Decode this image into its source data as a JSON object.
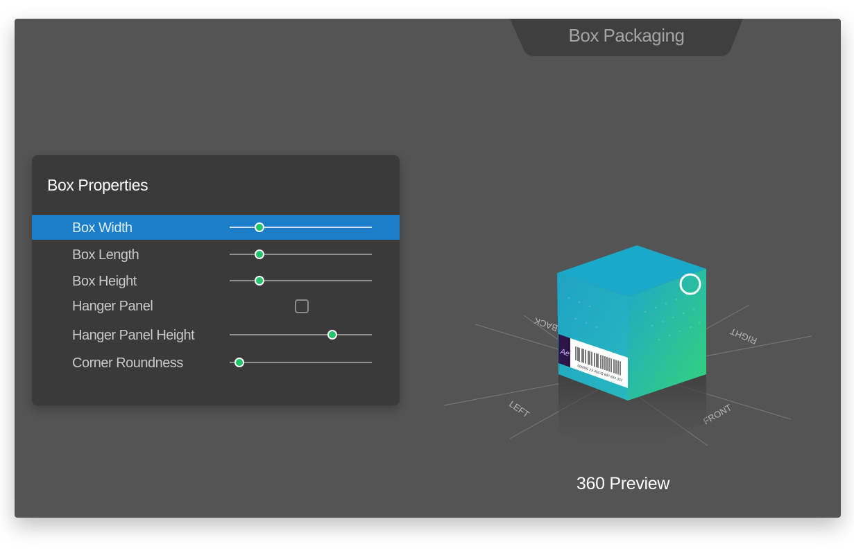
{
  "app": {
    "title": "Box Packaging"
  },
  "panel": {
    "title": "Box Properties",
    "properties": [
      {
        "label": "Box Width",
        "type": "slider",
        "value": 0.21,
        "selected": true
      },
      {
        "label": "Box Length",
        "type": "slider",
        "value": 0.21,
        "selected": false
      },
      {
        "label": "Box Height",
        "type": "slider",
        "value": 0.21,
        "selected": false
      },
      {
        "label": "Hanger Panel",
        "type": "checkbox",
        "checked": false,
        "selected": false
      },
      {
        "label": "Hanger Panel Height",
        "type": "slider",
        "value": 0.72,
        "selected": false
      },
      {
        "label": "Corner Roundness",
        "type": "slider",
        "value": 0.07,
        "selected": false
      }
    ]
  },
  "preview": {
    "label": "360 Preview",
    "axis_labels": {
      "back": "BACK",
      "right": "RIGHT",
      "left": "LEFT",
      "front": "FRONT"
    },
    "box_colors": {
      "teal": "#1fa8c8",
      "green": "#33d37a"
    },
    "barcode_text": "000001 23 45678 987 654 321",
    "side_logo_text": "Ae"
  },
  "colors": {
    "window_bg": "#545454",
    "panel_bg": "#3a3a3a",
    "selection": "#1c7dc8",
    "slider_thumb": "#23c36b"
  }
}
